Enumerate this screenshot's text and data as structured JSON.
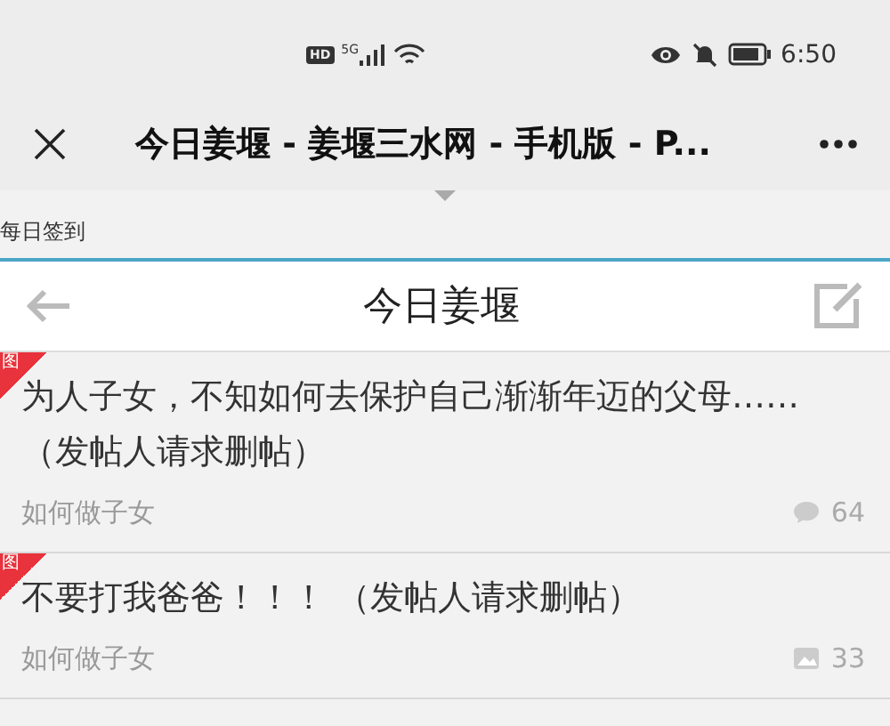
{
  "status_bar": {
    "hd": "HD",
    "network": "5G",
    "time": "6:50"
  },
  "browser": {
    "title": "今日姜堰 - 姜堰三水网 - 手机版 - P..."
  },
  "sign_in_bar": {
    "label": "每日签到"
  },
  "header": {
    "title": "今日姜堰"
  },
  "posts": [
    {
      "badge": "图",
      "title": "为人子女，不知如何去保护自己渐渐年迈的父母……（发帖人请求删帖）",
      "category": "如何做子女",
      "kind": "comment",
      "count": "64"
    },
    {
      "badge": "图",
      "title": "不要打我爸爸！！！ （发帖人请求删帖）",
      "category": "如何做子女",
      "kind": "image",
      "count": "33"
    }
  ]
}
